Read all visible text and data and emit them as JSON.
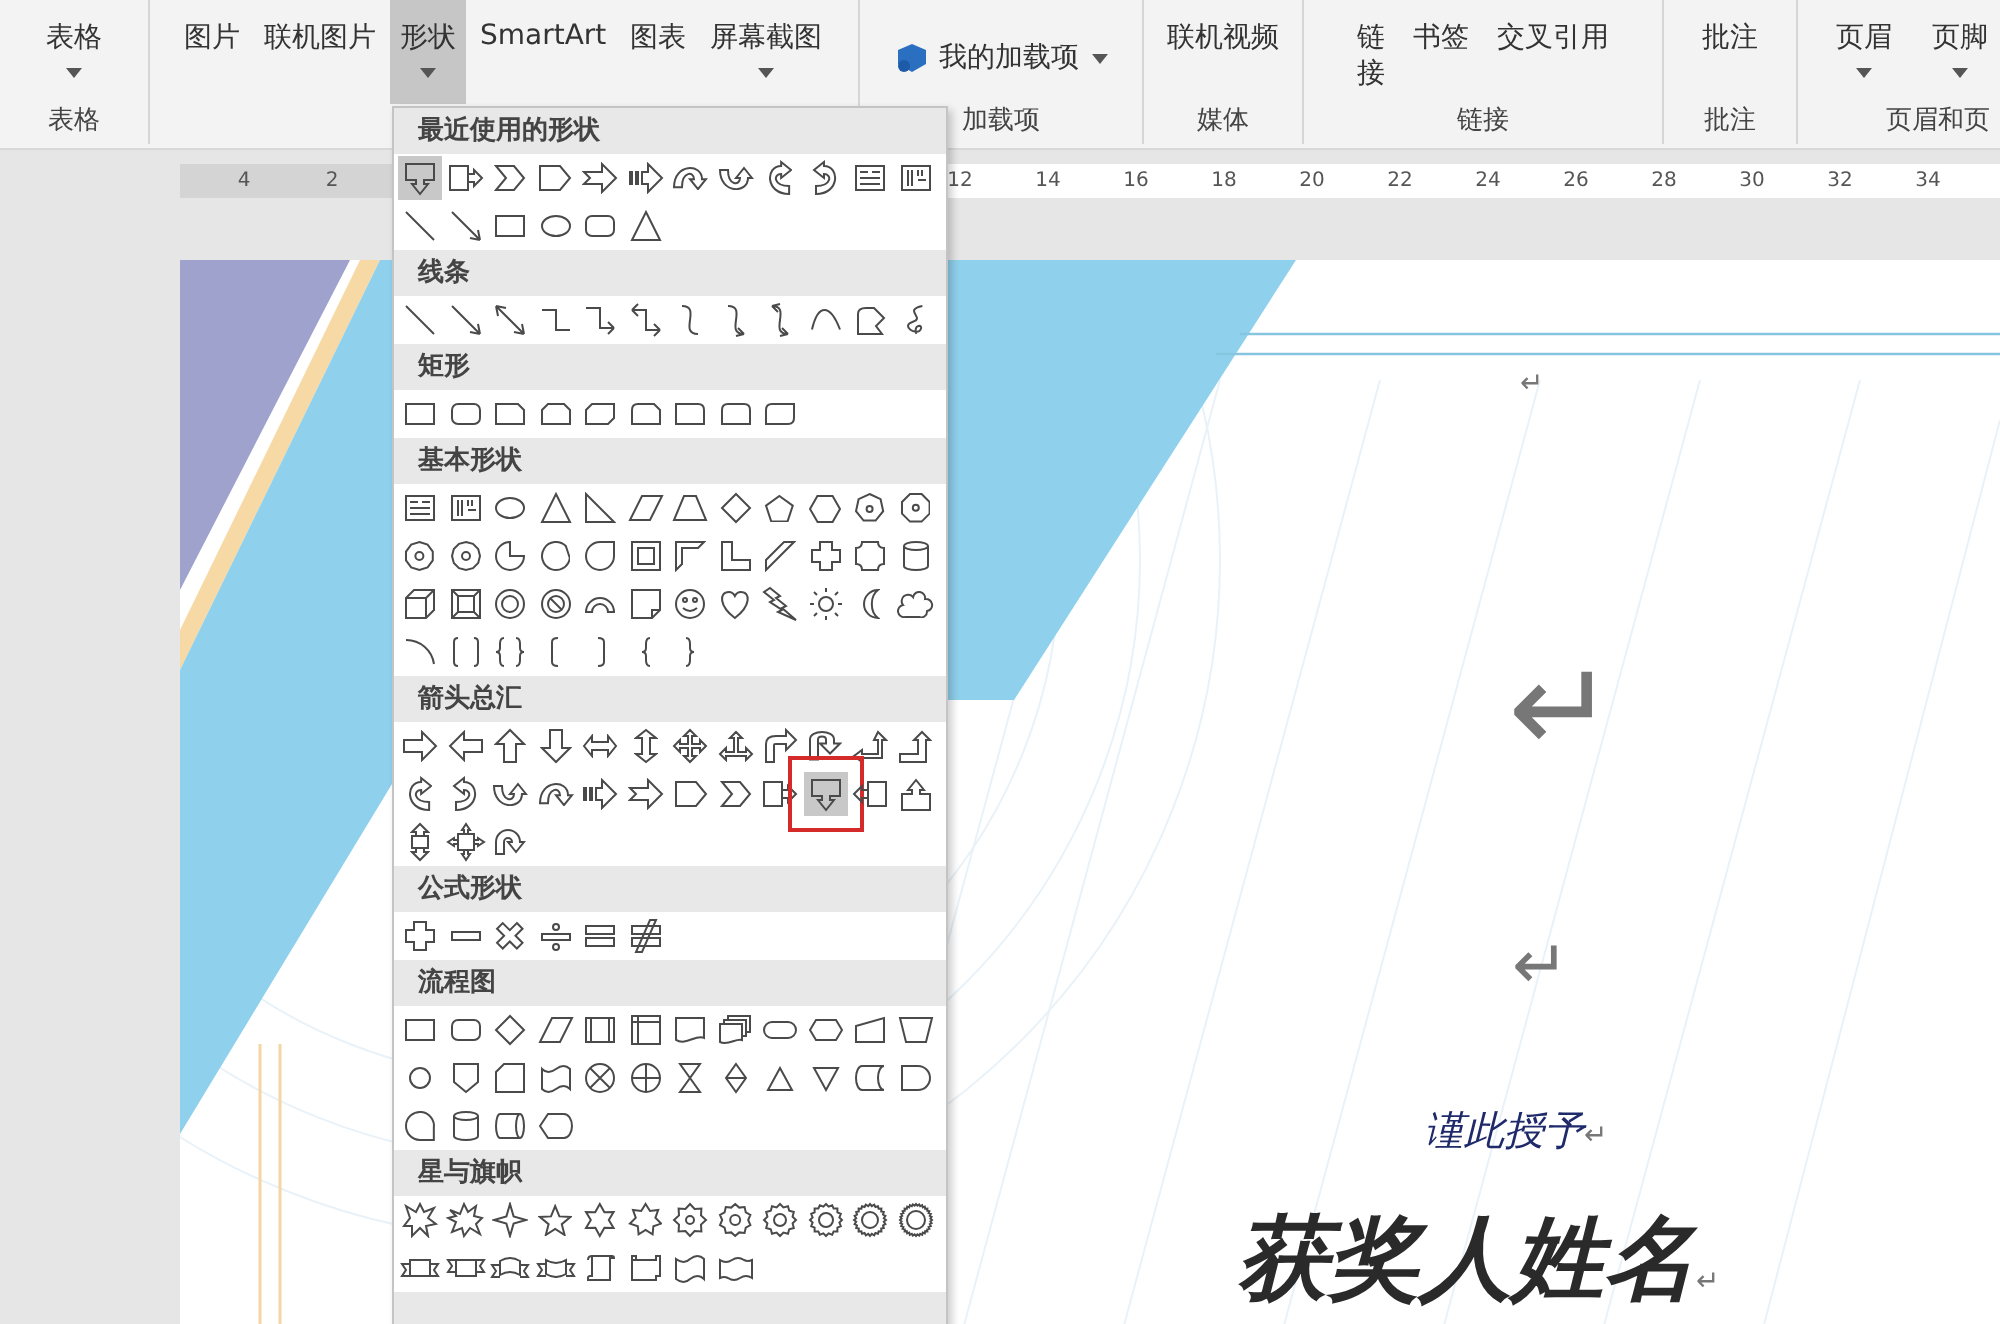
{
  "ribbon": {
    "groups": [
      {
        "label": "表格",
        "buttons": [
          {
            "label": "表格",
            "kind": "large",
            "dropdown": true,
            "pressed": false
          }
        ]
      },
      {
        "buttons": [
          {
            "label": "图片",
            "kind": "large",
            "dropdown": false,
            "pressed": false
          },
          {
            "label": "联机图片",
            "kind": "large",
            "dropdown": false,
            "pressed": false
          },
          {
            "label": "形状",
            "kind": "large",
            "dropdown": true,
            "pressed": true
          },
          {
            "label": "SmartArt",
            "kind": "large",
            "dropdown": false,
            "pressed": false
          },
          {
            "label": "图表",
            "kind": "large",
            "dropdown": false,
            "pressed": false
          },
          {
            "label": "屏幕截图",
            "kind": "large",
            "dropdown": true,
            "pressed": false
          }
        ]
      },
      {
        "label": "加载项",
        "buttons": [
          {
            "label": "我的加载项",
            "kind": "addin",
            "dropdown": true,
            "pressed": false
          }
        ]
      },
      {
        "label": "媒体",
        "buttons": [
          {
            "label": "联机视频",
            "kind": "large",
            "dropdown": false,
            "pressed": false
          }
        ]
      },
      {
        "label": "链接",
        "buttons": [
          {
            "label": "链接",
            "kind": "narrow",
            "dropdown": false,
            "pressed": false
          },
          {
            "label": "书签",
            "kind": "large",
            "dropdown": false,
            "pressed": false
          },
          {
            "label": "交叉引用",
            "kind": "large",
            "dropdown": false,
            "pressed": false
          }
        ]
      },
      {
        "label": "批注",
        "buttons": [
          {
            "label": "批注",
            "kind": "large",
            "dropdown": false,
            "pressed": false
          }
        ]
      },
      {
        "label": "页眉和页",
        "buttons": [
          {
            "label": "页眉",
            "kind": "large",
            "dropdown": true,
            "pressed": false
          },
          {
            "label": "页脚",
            "kind": "large",
            "dropdown": true,
            "pressed": false
          }
        ]
      }
    ]
  },
  "ruler": {
    "left_labels": [
      "4",
      "2"
    ],
    "right_labels": [
      "12",
      "14",
      "16",
      "18",
      "20",
      "22",
      "24",
      "26",
      "28",
      "30",
      "32",
      "34"
    ]
  },
  "shapes_menu": {
    "sections": [
      {
        "title": "最近使用的形状",
        "shapes": [
          {
            "kind": "callout-down",
            "selected": true,
            "marked": false
          },
          {
            "kind": "callout-right",
            "selected": false,
            "marked": false
          },
          {
            "kind": "chevron",
            "selected": false,
            "marked": false
          },
          {
            "kind": "pentagon-arrow",
            "selected": false,
            "marked": false
          },
          {
            "kind": "notched-arrow",
            "selected": false,
            "marked": false
          },
          {
            "kind": "striped-arrow",
            "selected": false,
            "marked": false
          },
          {
            "kind": "curved-down-arrow",
            "selected": false,
            "marked": false
          },
          {
            "kind": "curved-up-arrow",
            "selected": false,
            "marked": false
          },
          {
            "kind": "curved-left-arrow",
            "selected": false,
            "marked": false
          },
          {
            "kind": "curved-right-arrow",
            "selected": false,
            "marked": false
          },
          {
            "kind": "text-frame",
            "selected": false,
            "marked": false
          },
          {
            "kind": "vertical-text-frame",
            "selected": false,
            "marked": false
          },
          {
            "kind": "line",
            "selected": false,
            "marked": false
          },
          {
            "kind": "arrow-line",
            "selected": false,
            "marked": false
          },
          {
            "kind": "rectangle",
            "selected": false,
            "marked": false
          },
          {
            "kind": "ellipse",
            "selected": false,
            "marked": false
          },
          {
            "kind": "rounded-rectangle",
            "selected": false,
            "marked": false
          },
          {
            "kind": "triangle",
            "selected": false,
            "marked": false
          }
        ]
      },
      {
        "title": "线条",
        "shapes": [
          {
            "kind": "line",
            "selected": false,
            "marked": false
          },
          {
            "kind": "arrow-line",
            "selected": false,
            "marked": false
          },
          {
            "kind": "double-arrow-line",
            "selected": false,
            "marked": false
          },
          {
            "kind": "elbow-line",
            "selected": false,
            "marked": false
          },
          {
            "kind": "elbow-arrow-line",
            "selected": false,
            "marked": false
          },
          {
            "kind": "elbow-double-arrow-line",
            "selected": false,
            "marked": false
          },
          {
            "kind": "curve-line",
            "selected": false,
            "marked": false
          },
          {
            "kind": "curve-arrow-line",
            "selected": false,
            "marked": false
          },
          {
            "kind": "curve-double-arrow-line",
            "selected": false,
            "marked": false
          },
          {
            "kind": "arch-curve",
            "selected": false,
            "marked": false
          },
          {
            "kind": "freeform",
            "selected": false,
            "marked": false
          },
          {
            "kind": "scribble",
            "selected": false,
            "marked": false
          }
        ]
      },
      {
        "title": "矩形",
        "shapes": [
          {
            "kind": "rectangle",
            "selected": false,
            "marked": false
          },
          {
            "kind": "rounded-rectangle",
            "selected": false,
            "marked": false
          },
          {
            "kind": "snip-corner-rectangle",
            "selected": false,
            "marked": false
          },
          {
            "kind": "snip-two-corner-rectangle",
            "selected": false,
            "marked": false
          },
          {
            "kind": "snip-diagonal-rectangle",
            "selected": false,
            "marked": false
          },
          {
            "kind": "snip-round-rectangle",
            "selected": false,
            "marked": false
          },
          {
            "kind": "round-corner-rectangle",
            "selected": false,
            "marked": false
          },
          {
            "kind": "round-two-corner-rectangle",
            "selected": false,
            "marked": false
          },
          {
            "kind": "round-diagonal-rectangle",
            "selected": false,
            "marked": false
          }
        ]
      },
      {
        "title": "基本形状",
        "shapes": [
          {
            "kind": "text-frame",
            "selected": false,
            "marked": false
          },
          {
            "kind": "vertical-text-frame",
            "selected": false,
            "marked": false
          },
          {
            "kind": "ellipse",
            "selected": false,
            "marked": false
          },
          {
            "kind": "triangle",
            "selected": false,
            "marked": false
          },
          {
            "kind": "right-triangle",
            "selected": false,
            "marked": false
          },
          {
            "kind": "parallelogram",
            "selected": false,
            "marked": false
          },
          {
            "kind": "trapezoid",
            "selected": false,
            "marked": false
          },
          {
            "kind": "diamond",
            "selected": false,
            "marked": false
          },
          {
            "kind": "pentagon",
            "selected": false,
            "marked": false
          },
          {
            "kind": "hexagon",
            "selected": false,
            "marked": false
          },
          {
            "kind": "heptagon",
            "selected": false,
            "marked": false
          },
          {
            "kind": "octagon",
            "selected": false,
            "marked": false
          },
          {
            "kind": "decagon",
            "selected": false,
            "marked": false
          },
          {
            "kind": "dodecagon",
            "selected": false,
            "marked": false
          },
          {
            "kind": "pie",
            "selected": false,
            "marked": false
          },
          {
            "kind": "chord",
            "selected": false,
            "marked": false
          },
          {
            "kind": "teardrop",
            "selected": false,
            "marked": false
          },
          {
            "kind": "frame",
            "selected": false,
            "marked": false
          },
          {
            "kind": "half-frame",
            "selected": false,
            "marked": false
          },
          {
            "kind": "l-shape",
            "selected": false,
            "marked": false
          },
          {
            "kind": "diagonal-stripe",
            "selected": false,
            "marked": false
          },
          {
            "kind": "cross",
            "selected": false,
            "marked": false
          },
          {
            "kind": "plaque",
            "selected": false,
            "marked": false
          },
          {
            "kind": "cylinder",
            "selected": false,
            "marked": false
          },
          {
            "kind": "cube",
            "selected": false,
            "marked": false
          },
          {
            "kind": "bevel",
            "selected": false,
            "marked": false
          },
          {
            "kind": "donut",
            "selected": false,
            "marked": false
          },
          {
            "kind": "no-symbol",
            "selected": false,
            "marked": false
          },
          {
            "kind": "block-arc",
            "selected": false,
            "marked": false
          },
          {
            "kind": "folded-corner",
            "selected": false,
            "marked": false
          },
          {
            "kind": "smiley",
            "selected": false,
            "marked": false
          },
          {
            "kind": "heart",
            "selected": false,
            "marked": false
          },
          {
            "kind": "lightning",
            "selected": false,
            "marked": false
          },
          {
            "kind": "sun",
            "selected": false,
            "marked": false
          },
          {
            "kind": "moon",
            "selected": false,
            "marked": false
          },
          {
            "kind": "cloud",
            "selected": false,
            "marked": false
          },
          {
            "kind": "arc",
            "selected": false,
            "marked": false
          },
          {
            "kind": "bracket-pair",
            "selected": false,
            "marked": false
          },
          {
            "kind": "brace-pair",
            "selected": false,
            "marked": false
          },
          {
            "kind": "left-bracket",
            "selected": false,
            "marked": false
          },
          {
            "kind": "right-bracket",
            "selected": false,
            "marked": false
          },
          {
            "kind": "left-brace",
            "selected": false,
            "marked": false
          },
          {
            "kind": "right-brace",
            "selected": false,
            "marked": false
          }
        ]
      },
      {
        "title": "箭头总汇",
        "shapes": [
          {
            "kind": "right-arrow",
            "selected": false,
            "marked": false
          },
          {
            "kind": "left-arrow",
            "selected": false,
            "marked": false
          },
          {
            "kind": "up-arrow",
            "selected": false,
            "marked": false
          },
          {
            "kind": "down-arrow",
            "selected": false,
            "marked": false
          },
          {
            "kind": "left-right-arrow",
            "selected": false,
            "marked": false
          },
          {
            "kind": "up-down-arrow",
            "selected": false,
            "marked": false
          },
          {
            "kind": "four-way-arrow",
            "selected": false,
            "marked": false
          },
          {
            "kind": "three-way-arrow",
            "selected": false,
            "marked": false
          },
          {
            "kind": "bent-arrow",
            "selected": false,
            "marked": false
          },
          {
            "kind": "u-turn-arrow",
            "selected": false,
            "marked": false
          },
          {
            "kind": "left-up-arrow",
            "selected": false,
            "marked": false
          },
          {
            "kind": "bent-up-arrow",
            "selected": false,
            "marked": false
          },
          {
            "kind": "curved-left-arrow",
            "selected": false,
            "marked": false
          },
          {
            "kind": "curved-right-arrow",
            "selected": false,
            "marked": false
          },
          {
            "kind": "curved-up-arrow",
            "selected": false,
            "marked": false
          },
          {
            "kind": "curved-down-arrow",
            "selected": false,
            "marked": false
          },
          {
            "kind": "striped-arrow",
            "selected": false,
            "marked": false
          },
          {
            "kind": "notched-arrow",
            "selected": false,
            "marked": false
          },
          {
            "kind": "pentagon-arrow",
            "selected": false,
            "marked": false
          },
          {
            "kind": "chevron",
            "selected": false,
            "marked": false
          },
          {
            "kind": "callout-right",
            "selected": false,
            "marked": false
          },
          {
            "kind": "callout-down",
            "selected": true,
            "marked": true
          },
          {
            "kind": "callout-left",
            "selected": false,
            "marked": false
          },
          {
            "kind": "callout-up",
            "selected": false,
            "marked": false
          },
          {
            "kind": "callout-up-down",
            "selected": false,
            "marked": false
          },
          {
            "kind": "callout-four-way",
            "selected": false,
            "marked": false
          },
          {
            "kind": "circular-arrow",
            "selected": false,
            "marked": false
          }
        ]
      },
      {
        "title": "公式形状",
        "shapes": [
          {
            "kind": "plus",
            "selected": false,
            "marked": false
          },
          {
            "kind": "minus",
            "selected": false,
            "marked": false
          },
          {
            "kind": "multiply",
            "selected": false,
            "marked": false
          },
          {
            "kind": "divide",
            "selected": false,
            "marked": false
          },
          {
            "kind": "equal",
            "selected": false,
            "marked": false
          },
          {
            "kind": "not-equal",
            "selected": false,
            "marked": false
          }
        ]
      },
      {
        "title": "流程图",
        "shapes": [
          {
            "kind": "rectangle",
            "selected": false,
            "marked": false
          },
          {
            "kind": "rounded-rectangle",
            "selected": false,
            "marked": false
          },
          {
            "kind": "diamond",
            "selected": false,
            "marked": false
          },
          {
            "kind": "parallelogram",
            "selected": false,
            "marked": false
          },
          {
            "kind": "predefined-process",
            "selected": false,
            "marked": false
          },
          {
            "kind": "internal-storage",
            "selected": false,
            "marked": false
          },
          {
            "kind": "document",
            "selected": false,
            "marked": false
          },
          {
            "kind": "multi-document",
            "selected": false,
            "marked": false
          },
          {
            "kind": "terminator",
            "selected": false,
            "marked": false
          },
          {
            "kind": "preparation",
            "selected": false,
            "marked": false
          },
          {
            "kind": "manual-input",
            "selected": false,
            "marked": false
          },
          {
            "kind": "manual-operation",
            "selected": false,
            "marked": false
          },
          {
            "kind": "connector",
            "selected": false,
            "marked": false
          },
          {
            "kind": "off-page-connector",
            "selected": false,
            "marked": false
          },
          {
            "kind": "card",
            "selected": false,
            "marked": false
          },
          {
            "kind": "punched-tape",
            "selected": false,
            "marked": false
          },
          {
            "kind": "summing-junction",
            "selected": false,
            "marked": false
          },
          {
            "kind": "or-junction",
            "selected": false,
            "marked": false
          },
          {
            "kind": "collate",
            "selected": false,
            "marked": false
          },
          {
            "kind": "sort",
            "selected": false,
            "marked": false
          },
          {
            "kind": "extract",
            "selected": false,
            "marked": false
          },
          {
            "kind": "merge",
            "selected": false,
            "marked": false
          },
          {
            "kind": "stored-data",
            "selected": false,
            "marked": false
          },
          {
            "kind": "delay",
            "selected": false,
            "marked": false
          },
          {
            "kind": "sequential-access",
            "selected": false,
            "marked": false
          },
          {
            "kind": "cylinder",
            "selected": false,
            "marked": false
          },
          {
            "kind": "direct-access",
            "selected": false,
            "marked": false
          },
          {
            "kind": "display",
            "selected": false,
            "marked": false
          }
        ]
      },
      {
        "title": "星与旗帜",
        "shapes": [
          {
            "kind": "explosion",
            "selected": false,
            "marked": false
          },
          {
            "kind": "explosion-2",
            "selected": false,
            "marked": false
          },
          {
            "kind": "star-4",
            "selected": false,
            "marked": false
          },
          {
            "kind": "star-5",
            "selected": false,
            "marked": false
          },
          {
            "kind": "star-6",
            "selected": false,
            "marked": false
          },
          {
            "kind": "star-7",
            "selected": false,
            "marked": false
          },
          {
            "kind": "star-8",
            "selected": false,
            "marked": false
          },
          {
            "kind": "star-10",
            "selected": false,
            "marked": false
          },
          {
            "kind": "star-12",
            "selected": false,
            "marked": false
          },
          {
            "kind": "star-16",
            "selected": false,
            "marked": false
          },
          {
            "kind": "star-24",
            "selected": false,
            "marked": false
          },
          {
            "kind": "star-32",
            "selected": false,
            "marked": false
          },
          {
            "kind": "ribbon-down",
            "selected": false,
            "marked": false
          },
          {
            "kind": "ribbon-up",
            "selected": false,
            "marked": false
          },
          {
            "kind": "curved-ribbon-down",
            "selected": false,
            "marked": false
          },
          {
            "kind": "curved-ribbon-up",
            "selected": false,
            "marked": false
          },
          {
            "kind": "vertical-scroll",
            "selected": false,
            "marked": false
          },
          {
            "kind": "horizontal-scroll",
            "selected": false,
            "marked": false
          },
          {
            "kind": "wave",
            "selected": false,
            "marked": false
          },
          {
            "kind": "double-wave",
            "selected": false,
            "marked": false
          }
        ]
      }
    ]
  },
  "document": {
    "paragraphs": [
      {
        "kind": "mark-small",
        "text": "↵"
      },
      {
        "kind": "mark-large",
        "text": "↵"
      },
      {
        "kind": "mark-medium",
        "text": "↵"
      },
      {
        "kind": "subtitle",
        "text": "谨此授予",
        "mark": "↵"
      },
      {
        "kind": "title",
        "text": "获奖人姓名",
        "mark": "↵"
      }
    ]
  }
}
